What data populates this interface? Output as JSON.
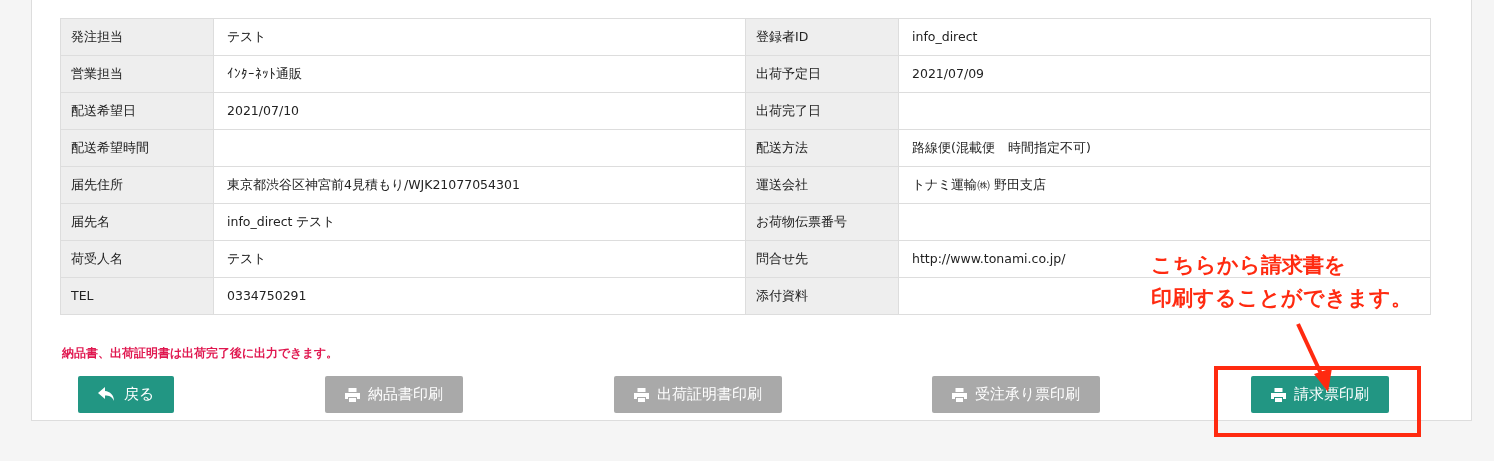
{
  "details": [
    {
      "label": "発注担当",
      "value": "テスト"
    },
    {
      "label": "登録者ID",
      "value": "info_direct"
    },
    {
      "label": "営業担当",
      "value": "ｲﾝﾀｰﾈｯﾄ通販"
    },
    {
      "label": "出荷予定日",
      "value": "2021/07/09"
    },
    {
      "label": "配送希望日",
      "value": "2021/07/10"
    },
    {
      "label": "出荷完了日"
    },
    {
      "label": "配送希望時間"
    },
    {
      "label": "配送方法",
      "value": "路線便(混載便　時間指定不可)"
    },
    {
      "label": "届先住所",
      "value": "東京都渋谷区神宮前4見積もり/WJK21077054301"
    },
    {
      "label": "運送会社",
      "value": "トナミ運輸㈱ 野田支店"
    },
    {
      "label": "届先名",
      "value": "info_direct テスト"
    },
    {
      "label": "お荷物伝票番号"
    },
    {
      "label": "荷受人名",
      "value": "テスト"
    },
    {
      "label": "問合せ先",
      "value": "http://www.tonami.co.jp/"
    },
    {
      "label": "TEL",
      "value": "0334750291"
    },
    {
      "label": "添付資料"
    }
  ],
  "note": "納品書、出荷証明書は出荷完了後に出力できます。",
  "buttons": [
    {
      "label": "戻る",
      "kind": "back",
      "disabled": false
    },
    {
      "label": "納品書印刷",
      "kind": "print",
      "disabled": true
    },
    {
      "label": "出荷証明書印刷",
      "kind": "print",
      "disabled": true
    },
    {
      "label": "受注承り票印刷",
      "kind": "print",
      "disabled": true
    },
    {
      "label": "請求票印刷",
      "kind": "print",
      "disabled": false
    }
  ],
  "annotation": {
    "lines": [
      "こちらから請求書を",
      "印刷することができます。"
    ]
  }
}
